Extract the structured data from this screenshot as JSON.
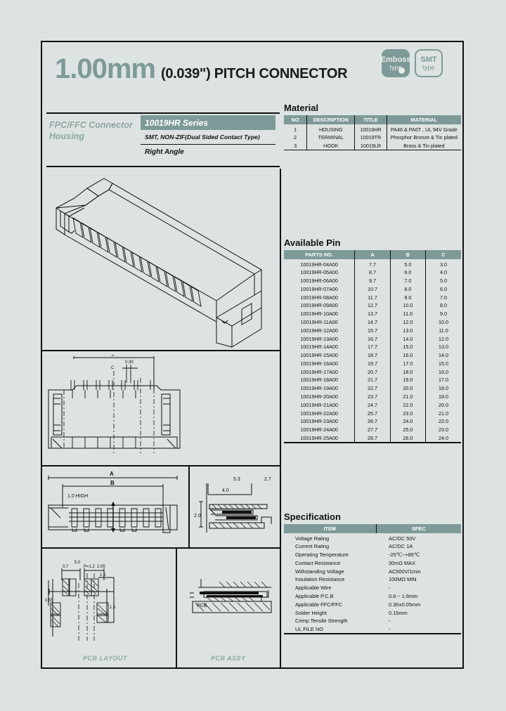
{
  "header": {
    "title_main": "1.00mm",
    "title_sub": "(0.039\") PITCH CONNECTOR",
    "badges": [
      {
        "name": "emboss-type-badge",
        "line1": "Emboss",
        "line2": "type"
      },
      {
        "name": "smt-type-badge",
        "line1": "SMT",
        "line2": "type"
      }
    ]
  },
  "info": {
    "category": "FPC/FFC Connector Housing",
    "series": "10019HR Series",
    "description": "SMT, NON-ZIF(Dual Sided Contact Type)",
    "angle": "Right Angle"
  },
  "material": {
    "heading": "Material",
    "columns": [
      "NO",
      "DESCRIPTION",
      "TITLE",
      "MATERIAL"
    ],
    "rows": [
      [
        "1",
        "HOUSING",
        "10019HR",
        "PA46 & PA6T , UL 94V Grade"
      ],
      [
        "2",
        "TERMINAL",
        "10019TR",
        "Phosphor Bronze & Tin plated"
      ],
      [
        "3",
        "HOOK",
        "10019LR",
        "Brass & Tin plated"
      ]
    ]
  },
  "available_pin": {
    "heading": "Available Pin",
    "columns": [
      "PARTS NO.",
      "A",
      "B",
      "C"
    ],
    "rows": [
      [
        "10019HR-04A00",
        "7.7",
        "5.0",
        "3.0"
      ],
      [
        "10019HR-05A00",
        "8.7",
        "6.0",
        "4.0"
      ],
      [
        "10019HR-06A00",
        "9.7",
        "7.0",
        "5.0"
      ],
      [
        "10019HR-07A00",
        "10.7",
        "8.0",
        "6.0"
      ],
      [
        "10019HR-08A00",
        "11.7",
        "9.0",
        "7.0"
      ],
      [
        "10019HR-09A00",
        "12.7",
        "10.0",
        "8.0"
      ],
      [
        "10019HR-10A00",
        "13.7",
        "11.0",
        "9.0"
      ],
      [
        "10019HR-11A00",
        "14.7",
        "12.0",
        "10.0"
      ],
      [
        "10019HR-12A00",
        "15.7",
        "13.0",
        "11.0"
      ],
      [
        "10019HR-13A00",
        "16.7",
        "14.0",
        "12.0"
      ],
      [
        "10019HR-14A00",
        "17.7",
        "15.0",
        "13.0"
      ],
      [
        "10019HR-15A00",
        "18.7",
        "16.0",
        "14.0"
      ],
      [
        "10019HR-16A00",
        "19.7",
        "17.0",
        "15.0"
      ],
      [
        "10019HR-17A00",
        "20.7",
        "18.0",
        "16.0"
      ],
      [
        "10019HR-18A00",
        "21.7",
        "19.0",
        "17.0"
      ],
      [
        "10019HR-19A00",
        "22.7",
        "20.0",
        "18.0"
      ],
      [
        "10019HR-20A00",
        "23.7",
        "21.0",
        "19.0"
      ],
      [
        "10019HR-21A00",
        "24.7",
        "22.0",
        "20.0"
      ],
      [
        "10019HR-22A00",
        "25.7",
        "23.0",
        "21.0"
      ],
      [
        "10019HR-23A00",
        "26.7",
        "24.0",
        "22.0"
      ],
      [
        "10019HR-24A00",
        "27.7",
        "25.0",
        "23.0"
      ],
      [
        "10019HR-25A00",
        "28.7",
        "26.0",
        "24.0"
      ]
    ]
  },
  "specification": {
    "heading": "Specification",
    "columns": [
      "ITEM",
      "SPEC"
    ],
    "rows": [
      [
        "Voltage Rating",
        "AC/DC 50V"
      ],
      [
        "Current Rating",
        "AC/DC 1A"
      ],
      [
        "Operating Temperature",
        "-25℃~+85℃"
      ],
      [
        "Contact Resistance",
        "30mΩ MAX"
      ],
      [
        "Withstanding Voltage",
        "AC500V/1min"
      ],
      [
        "Insulation Resistance",
        "100MΩ MIN"
      ],
      [
        "Applicable Wire",
        "-"
      ],
      [
        "Applicable P.C.B",
        "0.6 ~ 1.6mm"
      ],
      [
        "Applicable FFC/FFC",
        "0.30±0.05mm"
      ],
      [
        "Solder Height",
        "0.15mm"
      ],
      [
        "Crimp Tensile Strength",
        "-"
      ],
      [
        "UL FILE NO",
        "-"
      ]
    ]
  },
  "drawings": {
    "iso_view": "connector-isometric-view",
    "top_view": "connector-top-view",
    "side_view": "connector-side-view",
    "detail_view": "connector-detail-section-view",
    "dim_a": "A",
    "dim_b": "B",
    "dim_c": "C",
    "label_high": "1.0 HIGH",
    "label_030": "0.30",
    "label_pcb": "PCB",
    "pcb_layout_caption": "PCB LAYOUT",
    "pcb_assy_caption": "PCB ASSY"
  },
  "colors": {
    "page_bg": "#dde3e2",
    "accent_teal": "#7d9a99",
    "line": "#111111"
  }
}
